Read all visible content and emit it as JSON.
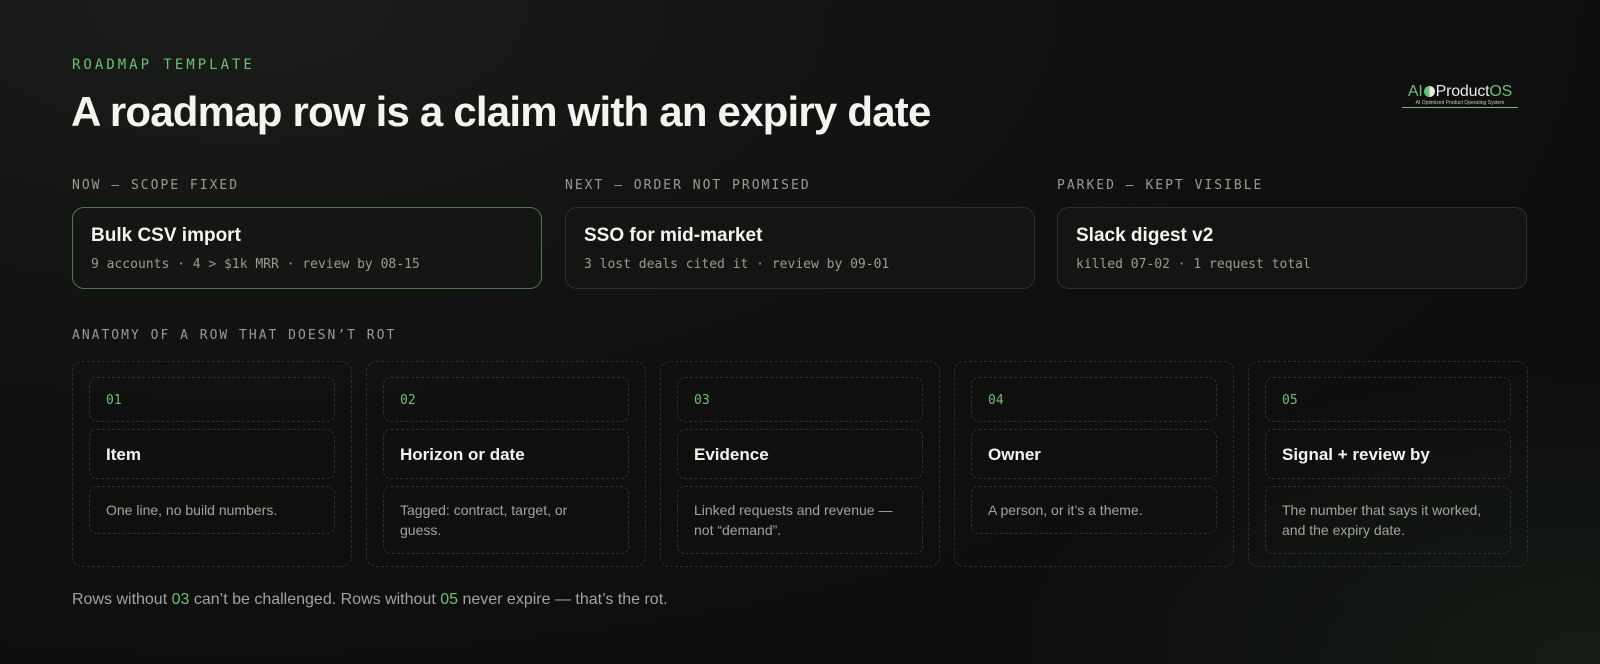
{
  "eyebrow": "ROADMAP TEMPLATE",
  "title": "A roadmap row is a claim with an expiry date",
  "logo": {
    "ai": "AI",
    "product": "Product",
    "os": "OS",
    "tagline": "AI Optimized Product Operating System"
  },
  "columns": [
    {
      "label": "NOW — SCOPE FIXED",
      "card_title": "Bulk CSV import",
      "card_meta": "9 accounts · 4 > $1k MRR · review by 08-15"
    },
    {
      "label": "NEXT — ORDER NOT PROMISED",
      "card_title": "SSO for mid-market",
      "card_meta": "3 lost deals cited it · review by 09-01"
    },
    {
      "label": "PARKED — KEPT VISIBLE",
      "card_title": "Slack digest v2",
      "card_meta": "killed 07-02 · 1 request total"
    }
  ],
  "anatomy": {
    "label": "ANATOMY OF A ROW THAT DOESN’T ROT",
    "items": [
      {
        "num": "01",
        "name": "Item",
        "desc": "One line, no build numbers."
      },
      {
        "num": "02",
        "name": "Horizon or date",
        "desc": "Tagged: contract, target, or guess."
      },
      {
        "num": "03",
        "name": "Evidence",
        "desc": "Linked requests and revenue — not “demand”."
      },
      {
        "num": "04",
        "name": "Owner",
        "desc": "A person, or it’s a theme."
      },
      {
        "num": "05",
        "name": "Signal + review by",
        "desc": "The number that says it worked, and the expiry date."
      }
    ]
  },
  "footer": {
    "part1": "Rows without ",
    "ref1": "03",
    "part2": " can’t be challenged. Rows without ",
    "ref2": "05",
    "part3": " never expire — that’s the rot."
  },
  "colors": {
    "accent": "#6fbf73",
    "background": "#0f100f",
    "active_border": "#4f7a4f"
  }
}
